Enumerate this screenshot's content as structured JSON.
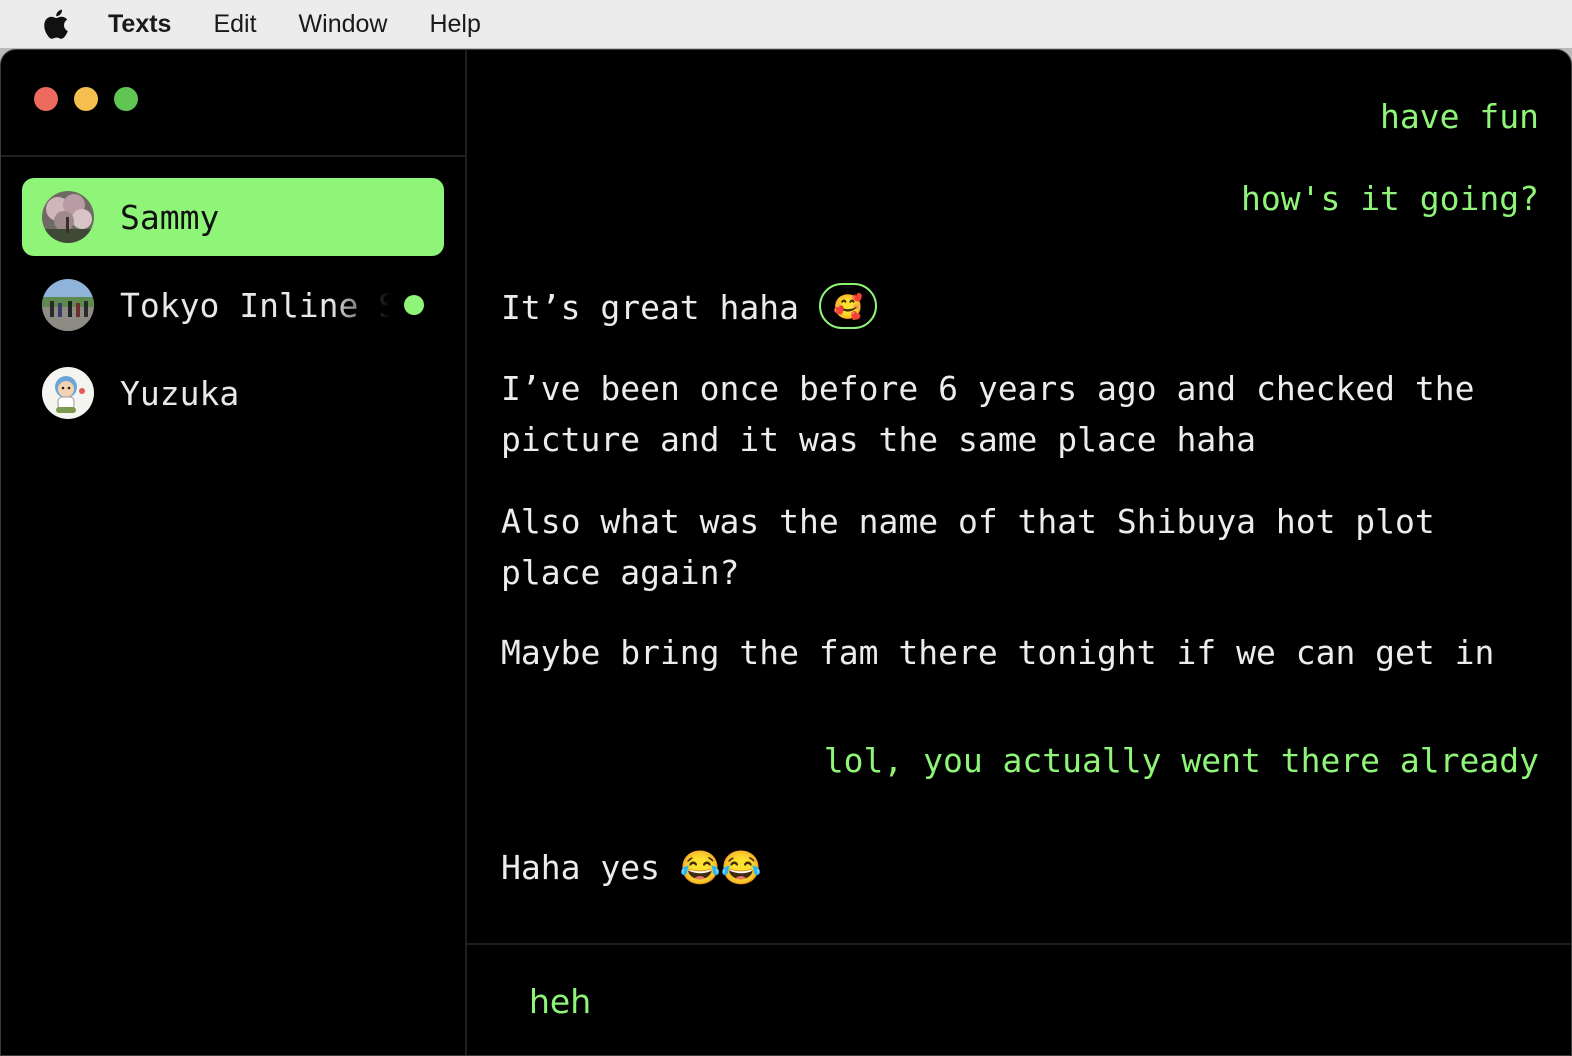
{
  "menubar": {
    "apple_icon": "apple-logo-icon",
    "items": [
      "Texts",
      "Edit",
      "Window",
      "Help"
    ]
  },
  "colors": {
    "accent": "#8ff579",
    "window_bg": "#000000",
    "incoming_text": "#ececec",
    "close": "#ed6a5e",
    "minimize": "#f5bf4f",
    "zoom": "#61c554"
  },
  "contacts": [
    {
      "name": "Sammy",
      "avatar": "cherry-blossom-photo",
      "active": true,
      "unread": false
    },
    {
      "name": "Tokyo Inline Skating",
      "avatar": "group-photo",
      "active": false,
      "unread": true
    },
    {
      "name": "Yuzuka",
      "avatar": "mascot-illustration",
      "active": false,
      "unread": false
    }
  ],
  "messages": [
    {
      "direction": "out",
      "text": "have fun"
    },
    {
      "direction": "out",
      "text": "how's it going?"
    },
    {
      "direction": "in",
      "text": "It’s great haha",
      "reaction": "🥰"
    },
    {
      "direction": "in",
      "lines": [
        "I’ve been once before 6 years ago and checked the",
        "picture and it was the same place haha"
      ]
    },
    {
      "direction": "in",
      "lines": [
        "Also what was the name of that Shibuya hot plot",
        "place again?"
      ]
    },
    {
      "direction": "in",
      "text": "Maybe bring the fam there tonight if we can get in"
    },
    {
      "direction": "out",
      "text": "lol, you actually went there already"
    },
    {
      "direction": "in",
      "text": "Haha yes 😂😂"
    }
  ],
  "composer": {
    "value": "heh"
  }
}
